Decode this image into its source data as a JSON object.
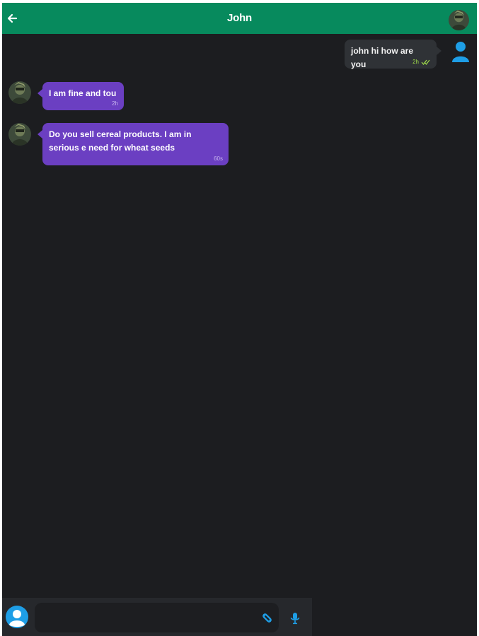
{
  "header": {
    "title": "John",
    "back_icon": "arrow-left-icon",
    "avatar_icon": "contact-avatar"
  },
  "messages": [
    {
      "direction": "outgoing",
      "text": "john hi how are you",
      "time": "2h",
      "status_icon": "double-check-icon"
    },
    {
      "direction": "incoming",
      "text": "I am fine and tou",
      "time": "2h"
    },
    {
      "direction": "incoming",
      "text": "Do you sell cereal products. I am in serious e need for wheat seeds",
      "time": "60s"
    }
  ],
  "composer": {
    "value": "",
    "placeholder": "",
    "attach_icon": "paperclip-icon",
    "mic_icon": "microphone-icon",
    "avatar_icon": "user-placeholder-icon"
  },
  "colors": {
    "header_bg": "#078a5d",
    "chat_bg": "#1c1d20",
    "outgoing_bubble": "#2f3236",
    "incoming_bubble": "#6b3fc2",
    "accent_blue": "#1e9ee6",
    "read_tick": "#9ed94a"
  }
}
